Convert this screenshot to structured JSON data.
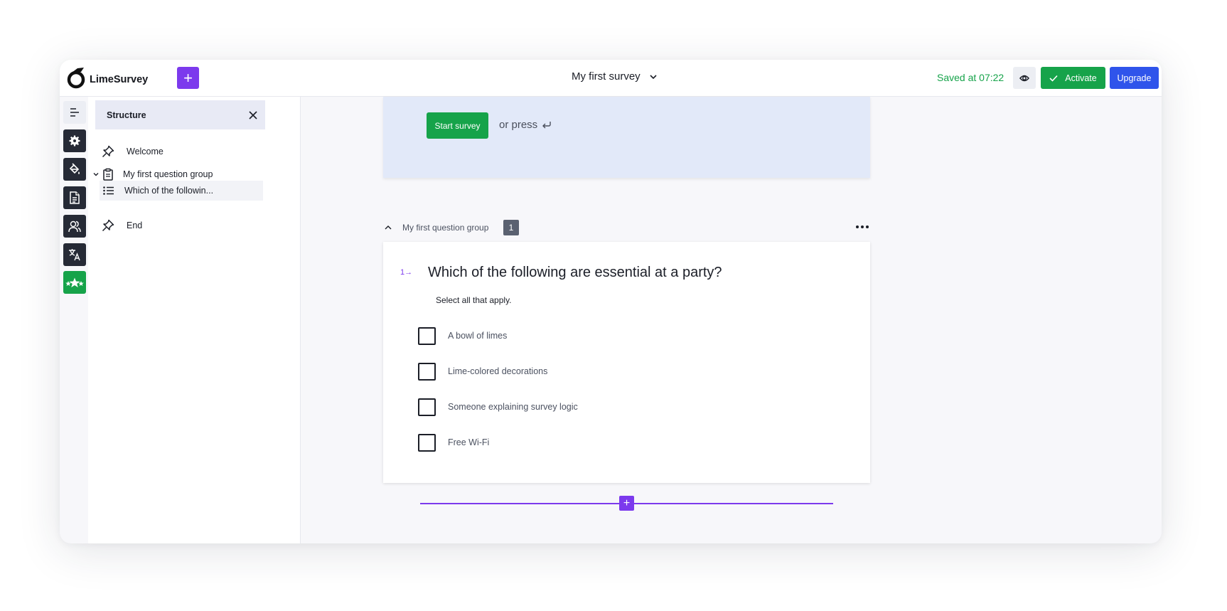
{
  "app": {
    "logo_text": "LimeSurvey",
    "create_label": "+"
  },
  "header": {
    "survey_title": "My first survey",
    "saved_text": "Saved at 07:22",
    "activate_label": "Activate",
    "upgrade_label": "Upgrade"
  },
  "structure": {
    "title": "Structure",
    "items": [
      {
        "label": "Welcome",
        "icon": "pin-icon"
      },
      {
        "label": "My first question group",
        "icon": "clipboard-icon"
      },
      {
        "label": "Which of the followin...",
        "icon": "list-icon"
      },
      {
        "label": "End",
        "icon": "pin-icon"
      }
    ]
  },
  "welcome": {
    "start_label": "Start survey",
    "or_press": "or press"
  },
  "group": {
    "title": "My first question group",
    "count": "1"
  },
  "question": {
    "number": "1",
    "text": "Which of the following are essential at a party?",
    "help": "Select all that apply.",
    "options": [
      "A bowl of limes",
      "Lime-colored decorations",
      "Someone explaining survey logic",
      "Free Wi-Fi"
    ]
  },
  "colors": {
    "primary": "#7c3aed",
    "success": "#16a34a",
    "upgrade": "#2f54eb",
    "rail_dark": "#262a36",
    "welcome_bg": "#e2e9f9"
  }
}
